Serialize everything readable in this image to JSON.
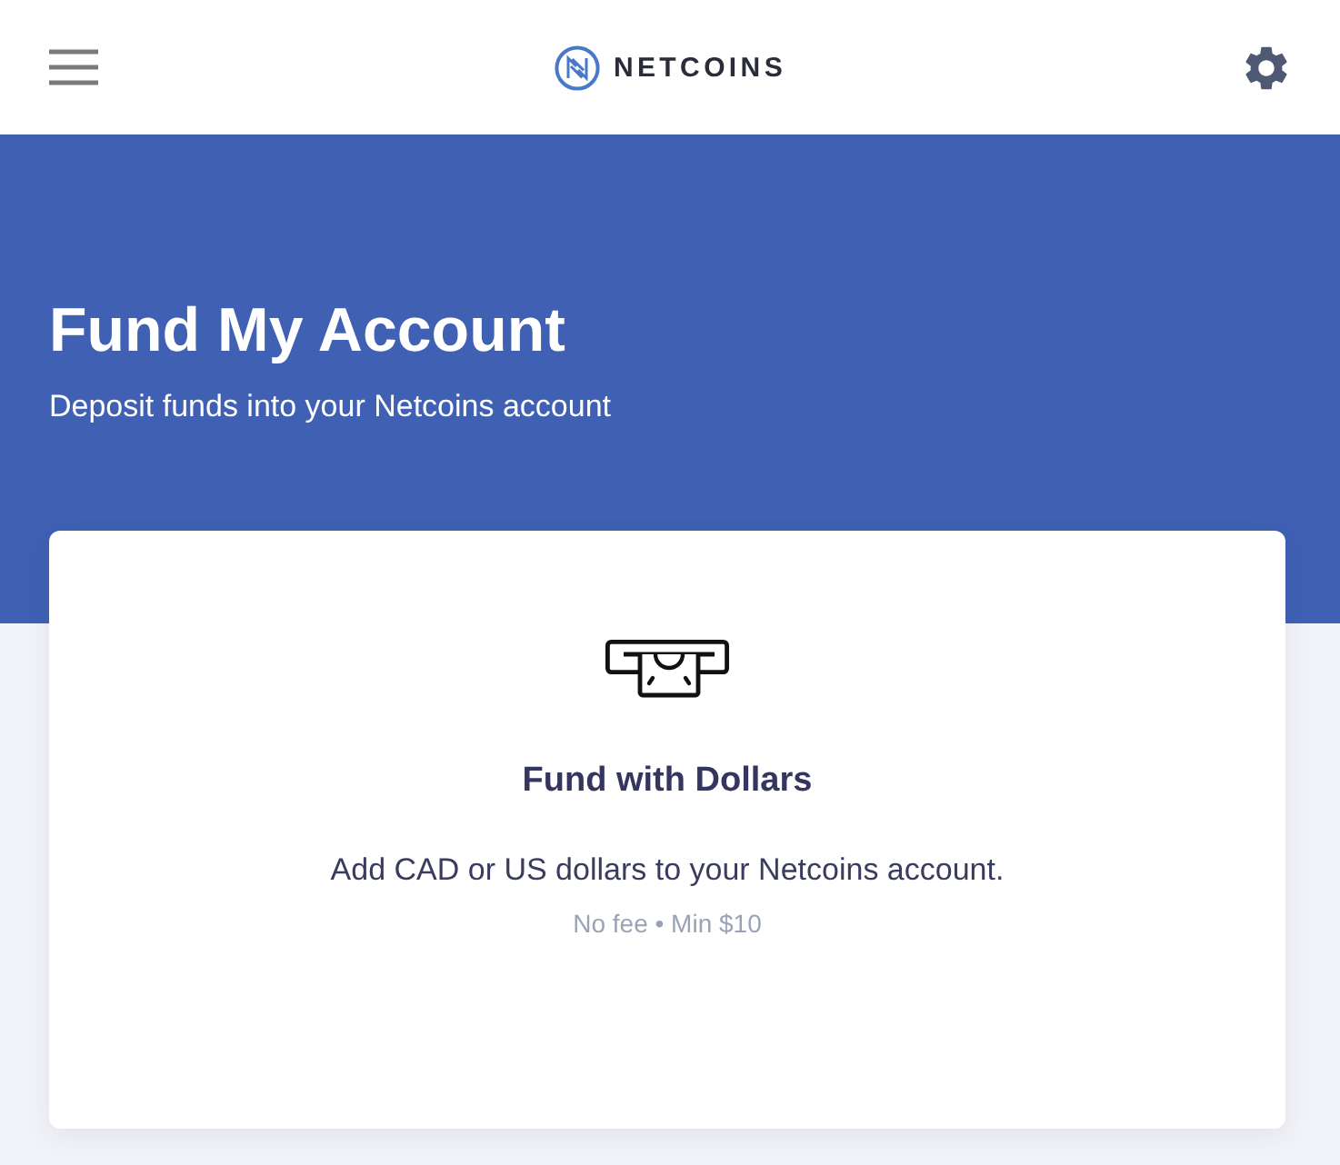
{
  "header": {
    "logo_text": "NETCOINS"
  },
  "hero": {
    "title": "Fund My Account",
    "subtitle": "Deposit funds into your Netcoins account"
  },
  "options": [
    {
      "kind": "dollars",
      "title": "Fund with Dollars",
      "description": "Add CAD or US dollars to your Netcoins account.",
      "details": "No fee • Min $10"
    }
  ]
}
